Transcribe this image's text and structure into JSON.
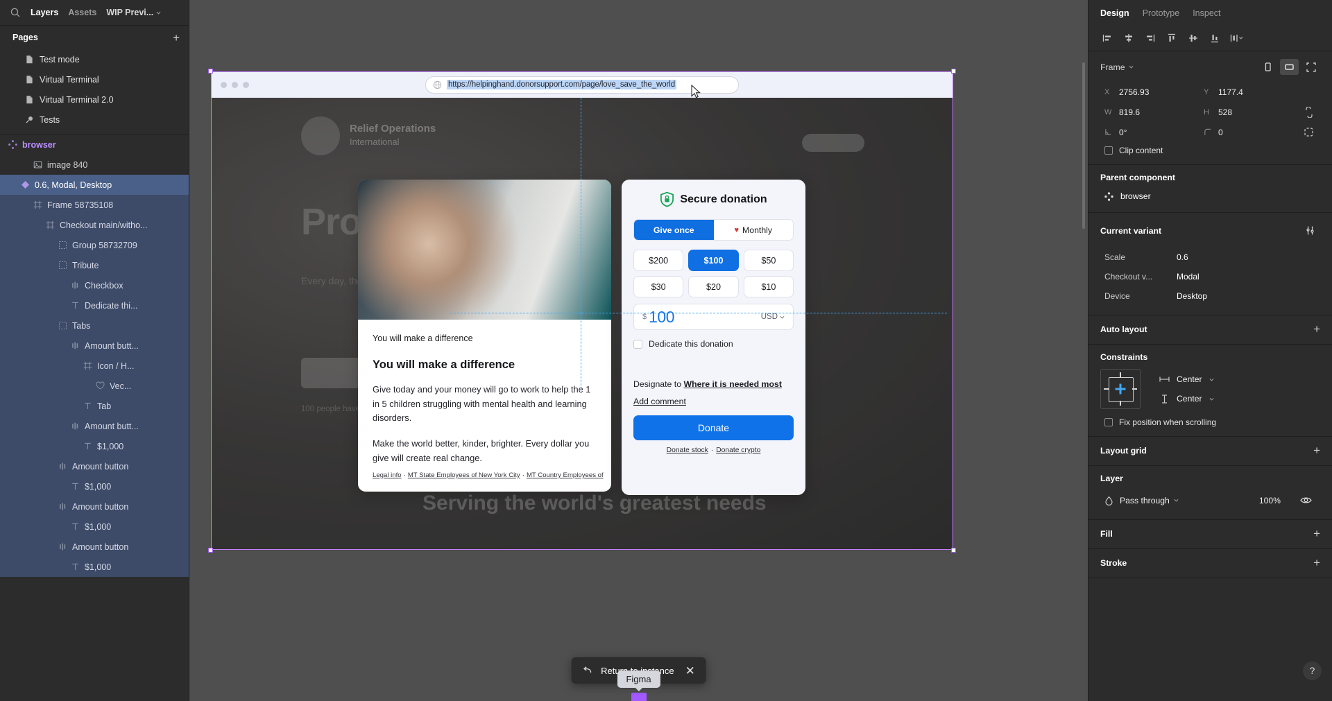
{
  "left_panel": {
    "tabs": [
      {
        "label": "Layers",
        "active": true
      },
      {
        "label": "Assets",
        "active": false
      },
      {
        "label": "WIP Previ...",
        "active": false
      }
    ],
    "search_icon": "search-icon",
    "pages_header": "Pages",
    "add_page_label": "+",
    "pages": [
      {
        "label": "Test mode",
        "icon": "page-icon"
      },
      {
        "label": "Virtual Terminal",
        "icon": "page-icon"
      },
      {
        "label": "Virtual Terminal 2.0",
        "icon": "page-icon"
      },
      {
        "label": "Tests",
        "icon": "search-page-icon"
      }
    ],
    "layers": [
      {
        "label": "browser",
        "indent": 0,
        "icon": "component-icon",
        "state": "component"
      },
      {
        "label": "image 840",
        "indent": 2,
        "icon": "image-icon",
        "state": "normal"
      },
      {
        "label": "0.6, Modal, Desktop",
        "indent": 1,
        "icon": "instance-icon",
        "state": "selected"
      },
      {
        "label": "Frame 58735108",
        "indent": 2,
        "icon": "frame-icon",
        "state": "inselect"
      },
      {
        "label": "Checkout main/witho...",
        "indent": 3,
        "icon": "frame-icon",
        "state": "inselect"
      },
      {
        "label": "Group 58732709",
        "indent": 4,
        "icon": "group-icon",
        "state": "inselect"
      },
      {
        "label": "Tribute",
        "indent": 4,
        "icon": "group-icon",
        "state": "inselect"
      },
      {
        "label": "Checkbox",
        "indent": 5,
        "icon": "variant-icon",
        "state": "inselect"
      },
      {
        "label": "Dedicate thi...",
        "indent": 5,
        "icon": "text-icon",
        "state": "inselect"
      },
      {
        "label": "Tabs",
        "indent": 4,
        "icon": "group-icon",
        "state": "inselect"
      },
      {
        "label": "Amount butt...",
        "indent": 5,
        "icon": "variant-icon",
        "state": "inselect"
      },
      {
        "label": "Icon / H...",
        "indent": 6,
        "icon": "frame-icon",
        "state": "inselect"
      },
      {
        "label": "Vec...",
        "indent": 7,
        "icon": "heart-icon",
        "state": "inselect"
      },
      {
        "label": "Tab",
        "indent": 6,
        "icon": "text-icon",
        "state": "inselect"
      },
      {
        "label": "Amount butt...",
        "indent": 5,
        "icon": "variant-icon",
        "state": "inselect"
      },
      {
        "label": "$1,000",
        "indent": 6,
        "icon": "text-icon",
        "state": "inselect"
      },
      {
        "label": "Amount button",
        "indent": 4,
        "icon": "variant-icon",
        "state": "inselect"
      },
      {
        "label": "$1,000",
        "indent": 5,
        "icon": "text-icon",
        "state": "inselect"
      },
      {
        "label": "Amount button",
        "indent": 4,
        "icon": "variant-icon",
        "state": "inselect"
      },
      {
        "label": "$1,000",
        "indent": 5,
        "icon": "text-icon",
        "state": "inselect"
      },
      {
        "label": "Amount button",
        "indent": 4,
        "icon": "variant-icon",
        "state": "inselect"
      },
      {
        "label": "$1,000",
        "indent": 5,
        "icon": "text-icon",
        "state": "inselect"
      }
    ]
  },
  "canvas": {
    "browser": {
      "url": "https://helpinghand.donorsupport.com/page/love_save_the_world",
      "globe_icon": "globe-icon",
      "window_dots": 3
    },
    "hero": {
      "org_title": "Relief Operations",
      "org_subtitle": "International",
      "headline": "Prov",
      "body": "Every day, the ... support and ... how innovativ...",
      "subnote": "100 people have ... donated",
      "section_heading": "Serving the world's greatest needs"
    },
    "story_card": {
      "kicker": "You will make a difference",
      "heading": "You will make a difference",
      "paragraph_1": "Give today and your money will go to work to help the 1 in 5 children struggling with mental health and learning disorders.",
      "paragraph_2": "Make the world better, kinder, brighter. Every dollar you give will create real change.",
      "footer_links": [
        "Legal info",
        "MT State Employees of New York City",
        "MT Country Employees of"
      ]
    },
    "donation": {
      "title": "Secure donation",
      "shield_icon": "shield-lock-icon",
      "frequency_tabs": [
        {
          "label": "Give once",
          "active": true,
          "icon": null
        },
        {
          "label": "Monthly",
          "active": false,
          "icon": "heart-icon"
        }
      ],
      "amounts": [
        {
          "label": "$200",
          "active": false
        },
        {
          "label": "$100",
          "active": true
        },
        {
          "label": "$50",
          "active": false
        },
        {
          "label": "$30",
          "active": false
        },
        {
          "label": "$20",
          "active": false
        },
        {
          "label": "$10",
          "active": false
        }
      ],
      "amount_input": {
        "currency_symbol": "$",
        "value": "100",
        "currency_code": "USD"
      },
      "dedicate_label": "Dedicate this donation",
      "designate_prefix": "Designate to",
      "designate_value": "Where it is needed most",
      "add_comment_label": "Add comment",
      "donate_button": "Donate",
      "alt_links": [
        "Donate stock",
        "Donate crypto"
      ]
    },
    "return_bar": {
      "label": "Return to instance",
      "back_icon": "back-arrow-icon",
      "close_icon": "close-icon"
    },
    "tooltip": "Figma"
  },
  "right_panel": {
    "tabs": [
      {
        "label": "Design",
        "active": true
      },
      {
        "label": "Prototype",
        "active": false
      },
      {
        "label": "Inspect",
        "active": false
      }
    ],
    "align_buttons": [
      "align-left-icon",
      "align-horizontal-center-icon",
      "align-right-icon",
      "align-top-icon",
      "align-vertical-center-icon",
      "align-bottom-icon",
      "distribute-icon"
    ],
    "frame_section": {
      "label": "Frame",
      "portrait_icon": "portrait-orientation-icon",
      "landscape_icon": "landscape-orientation-icon",
      "resize_icon": "resize-to-fit-icon",
      "properties": [
        {
          "key": "X",
          "value": "2756.93"
        },
        {
          "key": "Y",
          "value": "1177.4"
        },
        {
          "key": "W",
          "value": "819.6"
        },
        {
          "key": "H",
          "value": "528"
        },
        {
          "key": "rotation",
          "value": "0°"
        },
        {
          "key": "corner-radius",
          "value": "0"
        }
      ],
      "clip_content_label": "Clip content",
      "clip_content_checked": false
    },
    "parent_component": {
      "title": "Parent component",
      "name": "browser",
      "icon": "component-icon"
    },
    "current_variant": {
      "title": "Current variant",
      "settings_icon": "variant-settings-icon",
      "properties": [
        {
          "key": "Scale",
          "value": "0.6"
        },
        {
          "key": "Checkout v...",
          "value": "Modal"
        },
        {
          "key": "Device",
          "value": "Desktop"
        }
      ]
    },
    "auto_layout": {
      "title": "Auto layout",
      "add_label": "+"
    },
    "constraints": {
      "title": "Constraints",
      "horizontal": "Center",
      "vertical": "Center",
      "fix_position_label": "Fix position when scrolling",
      "fix_position_checked": false
    },
    "layout_grid": {
      "title": "Layout grid",
      "add_label": "+"
    },
    "layer": {
      "title": "Layer",
      "blend_mode": "Pass through",
      "opacity": "100%",
      "visibility_icon": "eye-icon"
    },
    "fill": {
      "title": "Fill",
      "add_label": "+"
    },
    "stroke": {
      "title": "Stroke",
      "add_label": "+"
    },
    "help_label": "?"
  }
}
